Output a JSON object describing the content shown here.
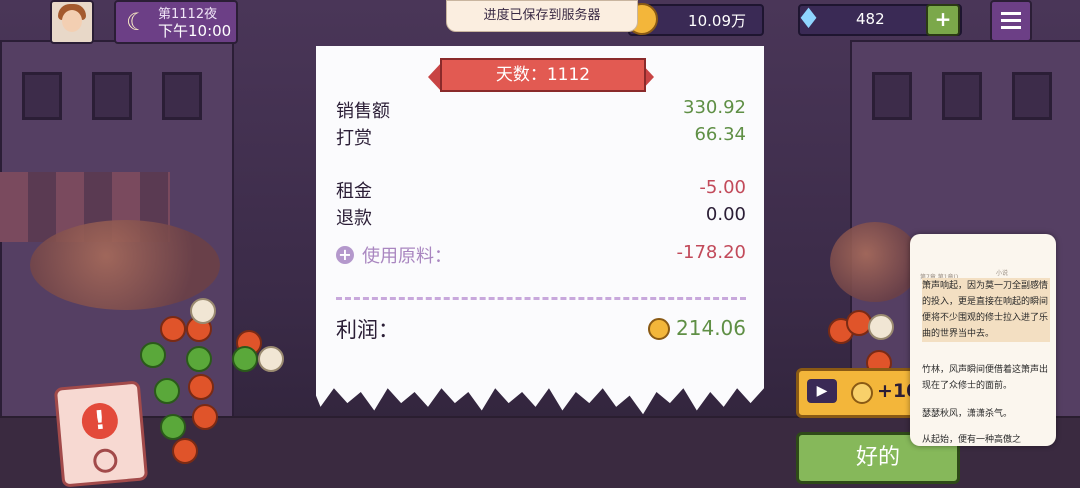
{
  "topbar": {
    "day_label": "第1112夜",
    "time_label": "下午10:00",
    "save_toast": "进度已保存到服务器",
    "coins": "10.09万",
    "gems": "482",
    "add_label": "+"
  },
  "receipt": {
    "day_banner": "天数：1112",
    "rows": [
      {
        "label": "销售额",
        "value": "330.92"
      },
      {
        "label": "打赏",
        "value": "66.34"
      },
      {
        "label": "租金",
        "value": "-5.00"
      },
      {
        "label": "退款",
        "value": "0.00"
      },
      {
        "label": "使用原料：",
        "value": "-178.20"
      }
    ],
    "profit_label": "利润：",
    "profit_value": "214.06"
  },
  "ad_button": {
    "label": "+10"
  },
  "ok_button": {
    "label": "好的"
  },
  "reader": {
    "header_left": "第7章 第1章()",
    "header_right": "小说",
    "paragraphs": [
      "箫声响起，因为莫一刀全副感情的投入，更是直接在响起的瞬间便将不少围观的修士拉入进了乐曲的世界当中去。",
      "竹林，风声瞬间便借着这箫声出现在了众修士的面前。",
      "瑟瑟秋风，潇潇杀气。",
      "从起始，便有一种高傲之"
    ]
  }
}
